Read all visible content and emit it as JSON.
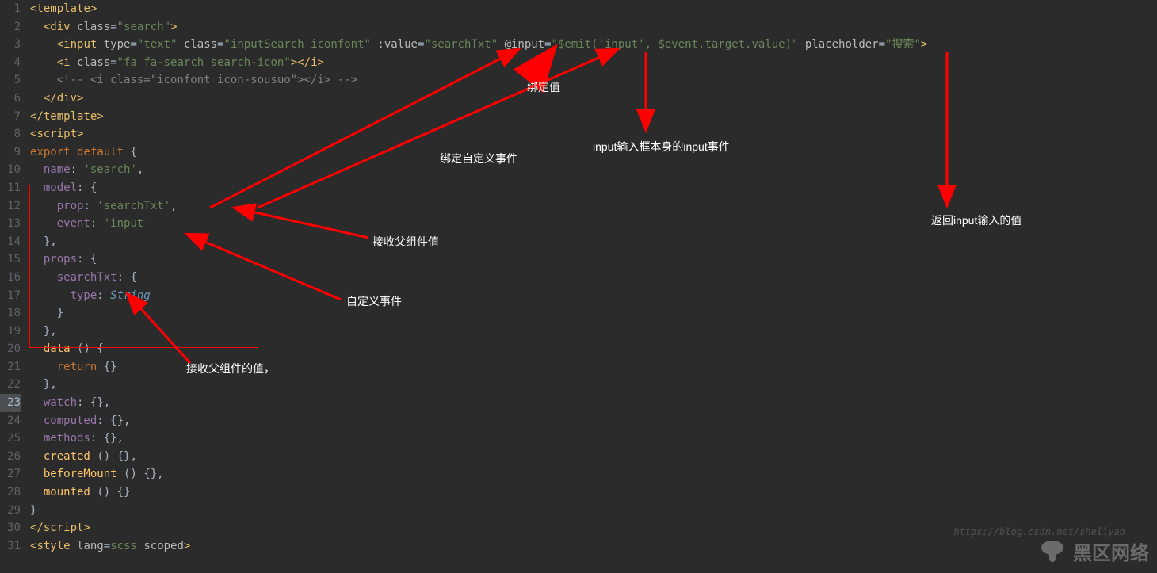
{
  "gutter": {
    "lines": [
      "1",
      "2",
      "3",
      "4",
      "5",
      "6",
      "7",
      "8",
      "9",
      "10",
      "11",
      "12",
      "13",
      "14",
      "15",
      "16",
      "17",
      "18",
      "19",
      "20",
      "21",
      "22",
      "23",
      "24",
      "25",
      "26",
      "27",
      "28",
      "29",
      "30",
      "31"
    ],
    "highlighted": "23"
  },
  "code": {
    "line1": {
      "open": "<",
      "tag": "template",
      "close": ">"
    },
    "line2": {
      "indent": "  ",
      "open": "<",
      "tag": "div",
      "space": " ",
      "attr": "class",
      "eq": "=",
      "val": "\"search\"",
      "close": ">"
    },
    "line3": {
      "indent": "    ",
      "open": "<",
      "tag": "input",
      "s1": " ",
      "a1": "type",
      "e1": "=",
      "v1": "\"text\"",
      "s2": " ",
      "a2": "class",
      "e2": "=",
      "v2": "\"inputSearch iconfont\"",
      "s3": " ",
      "a3": ":value",
      "e3": "=",
      "v3": "\"searchTxt\"",
      "s4": " ",
      "a4": "@input",
      "e4": "=",
      "v4": "\"$emit('input', $event.target.value)\"",
      "s5": " ",
      "a5": "placeholder",
      "e5": "=",
      "v5": "\"搜索\"",
      "close": ">"
    },
    "line4": {
      "indent": "    ",
      "open": "<",
      "tag": "i",
      "s1": " ",
      "a1": "class",
      "e1": "=",
      "v1": "\"fa fa-search search-icon\"",
      "close": ">",
      "open2": "</",
      "tag2": "i",
      "close2": ">"
    },
    "line5": {
      "indent": "    ",
      "comment": "<!-- <i class=\"iconfont icon-sousuo\"></i> -->"
    },
    "line6": {
      "indent": "  ",
      "open": "</",
      "tag": "div",
      "close": ">"
    },
    "line7": {
      "open": "</",
      "tag": "template",
      "close": ">"
    },
    "line8": {
      "open": "<",
      "tag": "script",
      "close": ">"
    },
    "line9": {
      "kw1": "export",
      "s1": " ",
      "kw2": "default",
      "s2": " ",
      "brace": "{"
    },
    "line10": {
      "indent": "  ",
      "prop": "name",
      "colon": ": ",
      "val": "'search'",
      "comma": ","
    },
    "line11": {
      "indent": "  ",
      "prop": "model",
      "colon": ": ",
      "brace": "{"
    },
    "line12": {
      "indent": "    ",
      "prop": "prop",
      "colon": ": ",
      "val": "'searchTxt'",
      "comma": ","
    },
    "line13": {
      "indent": "    ",
      "prop": "event",
      "colon": ": ",
      "val": "'input'"
    },
    "line14": {
      "indent": "  ",
      "brace": "},"
    },
    "line15": {
      "indent": "  ",
      "prop": "props",
      "colon": ": ",
      "brace": "{"
    },
    "line16": {
      "indent": "    ",
      "prop": "searchTxt",
      "colon": ": ",
      "brace": "{"
    },
    "line17": {
      "indent": "      ",
      "prop": "type",
      "colon": ": ",
      "type": "String"
    },
    "line18": {
      "indent": "    ",
      "brace": "}"
    },
    "line19": {
      "indent": "  ",
      "brace": "},"
    },
    "line20": {
      "indent": "  ",
      "fn": "data",
      "s": " ",
      "paren": "()",
      "s2": " ",
      "brace": "{"
    },
    "line21": {
      "indent": "    ",
      "kw": "return",
      "s": " ",
      "brace": "{}"
    },
    "line22": {
      "indent": "  ",
      "brace": "},"
    },
    "line23": {
      "indent": "  ",
      "prop": "watch",
      "colon": ": ",
      "brace": "{},"
    },
    "line24": {
      "indent": "  ",
      "prop": "computed",
      "colon": ": ",
      "brace": "{},"
    },
    "line25": {
      "indent": "  ",
      "prop": "methods",
      "colon": ": ",
      "brace": "{},"
    },
    "line26": {
      "indent": "  ",
      "fn": "created",
      "s": " ",
      "paren": "()",
      "s2": " ",
      "brace": "{},"
    },
    "line27": {
      "indent": "  ",
      "fn": "beforeMount",
      "s": " ",
      "paren": "()",
      "s2": " ",
      "brace": "{},"
    },
    "line28": {
      "indent": "  ",
      "fn": "mounted",
      "s": " ",
      "paren": "()",
      "s2": " ",
      "brace": "{}"
    },
    "line29": {
      "brace": "}"
    },
    "line30": {
      "open": "</",
      "tag": "script",
      "close": ">"
    },
    "line31": {
      "open": "<",
      "tag": "style",
      "s1": " ",
      "a1": "lang",
      "e1": "=",
      "v1": "scss",
      "s2": " ",
      "a2": "scoped",
      "close": ">"
    }
  },
  "annotations": {
    "label1": "绑定值",
    "label2": "input输入框本身的input事件",
    "label3": "绑定自定义事件",
    "label4": "返回input输入的值",
    "label5": "接收父组件值",
    "label6": "自定义事件",
    "label7": "接收父组件的值，"
  },
  "watermark": {
    "text": "黑区网络",
    "url": "https://blog.csdn.net/shellyao"
  }
}
